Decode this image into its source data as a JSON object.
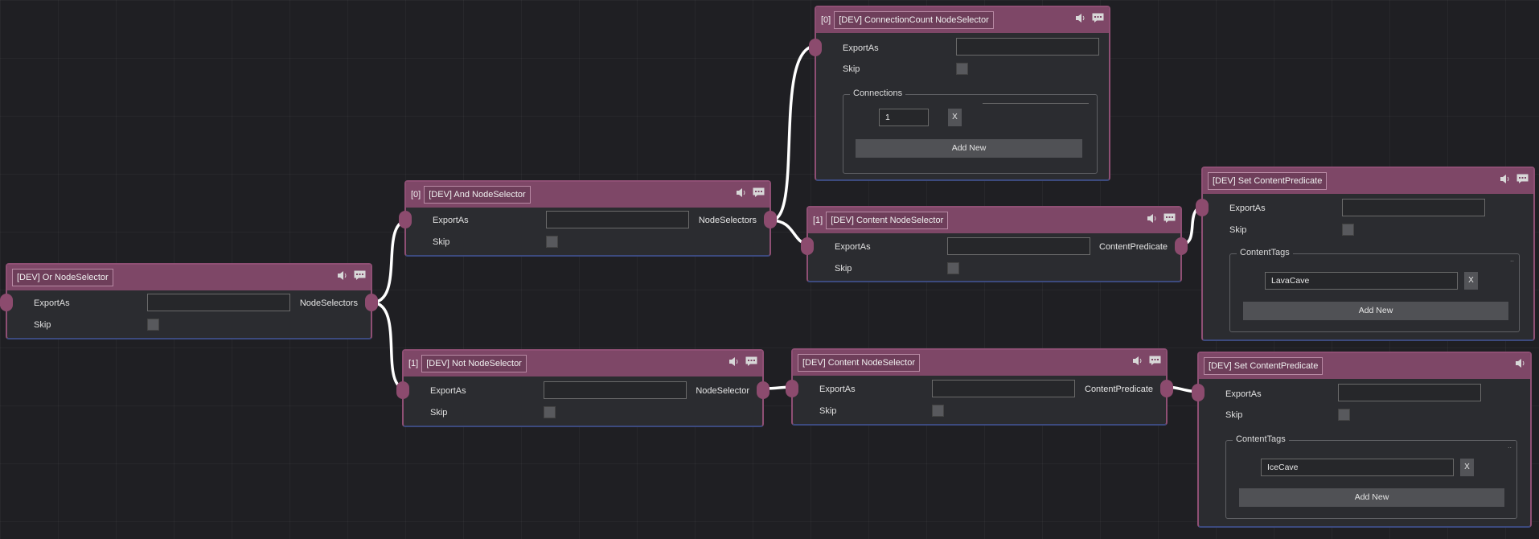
{
  "colors": {
    "canvas": "#1f1f23",
    "node_body": "#2b2c30",
    "node_header": "#7e4767",
    "node_border": "#8f4f74",
    "port": "#8c4b6e",
    "wire": "#ffffff"
  },
  "header_icons": [
    "speaker-icon",
    "comment-icon"
  ],
  "nodes": {
    "or_selector": {
      "index": "",
      "title": "[DEV] Or NodeSelector",
      "export_label": "ExportAs",
      "export_value": "",
      "skip_label": "Skip",
      "output_label": "NodeSelectors"
    },
    "and_selector": {
      "index": "[0]",
      "title": "[DEV] And NodeSelector",
      "export_label": "ExportAs",
      "export_value": "",
      "skip_label": "Skip",
      "output_label": "NodeSelectors"
    },
    "not_selector": {
      "index": "[1]",
      "title": "[DEV] Not NodeSelector",
      "export_label": "ExportAs",
      "export_value": "",
      "skip_label": "Skip",
      "output_label": "NodeSelector"
    },
    "connection_count": {
      "index": "[0]",
      "title": "[DEV] ConnectionCount NodeSelector",
      "export_label": "ExportAs",
      "export_value": "",
      "skip_label": "Skip",
      "group_label": "Connections",
      "item_value": "1",
      "remove_label": "X",
      "add_label": "Add New"
    },
    "content_selector_top": {
      "index": "[1]",
      "title": "[DEV] Content NodeSelector",
      "export_label": "ExportAs",
      "export_value": "",
      "skip_label": "Skip",
      "output_label": "ContentPredicate"
    },
    "content_selector_bottom": {
      "index": "",
      "title": "[DEV] Content NodeSelector",
      "export_label": "ExportAs",
      "export_value": "",
      "skip_label": "Skip",
      "output_label": "ContentPredicate"
    },
    "set_predicate_top": {
      "index": "",
      "title": "[DEV] Set ContentPredicate",
      "export_label": "ExportAs",
      "export_value": "",
      "skip_label": "Skip",
      "group_label": "ContentTags",
      "tag_value": "LavaCave",
      "remove_label": "X",
      "add_label": "Add New"
    },
    "set_predicate_bottom": {
      "index": "",
      "title": "[DEV] Set ContentPredicate",
      "export_label": "ExportAs",
      "export_value": "",
      "skip_label": "Skip",
      "group_label": "ContentTags",
      "tag_value": "IceCave",
      "remove_label": "X",
      "add_label": "Add New"
    }
  }
}
